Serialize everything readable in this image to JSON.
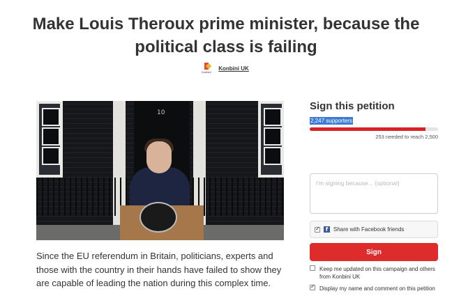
{
  "petition": {
    "title": "Make Louis Theroux prime minister, because the political class is failing",
    "author": {
      "name": "Konbini UK",
      "logo_text": "Konbini"
    },
    "photo": {
      "door_number": "10"
    },
    "description": "Since the EU referendum in Britain, politicians, experts and those with the country in their hands have failed to show they are capable of leading the nation during this complex time."
  },
  "sign_panel": {
    "title": "Sign this petition",
    "supporters": "2,247 supporters",
    "progress_fraction": 0.9,
    "needed": "253 needed to reach 2,500",
    "comment_placeholder": "I'm signing because... (optional)",
    "facebook_label": "Share with Facebook friends",
    "sign_button": "Sign",
    "keep_updated_label": "Keep me updated on this campaign and others from Konbini UK",
    "display_name_label": "Display my name and comment on this petition"
  },
  "colors": {
    "accent": "#de2c2c",
    "facebook": "#3b5998",
    "highlight": "#3b7bd4"
  },
  "icons": {
    "facebook": "facebook-icon",
    "checkbox": "check-icon"
  }
}
